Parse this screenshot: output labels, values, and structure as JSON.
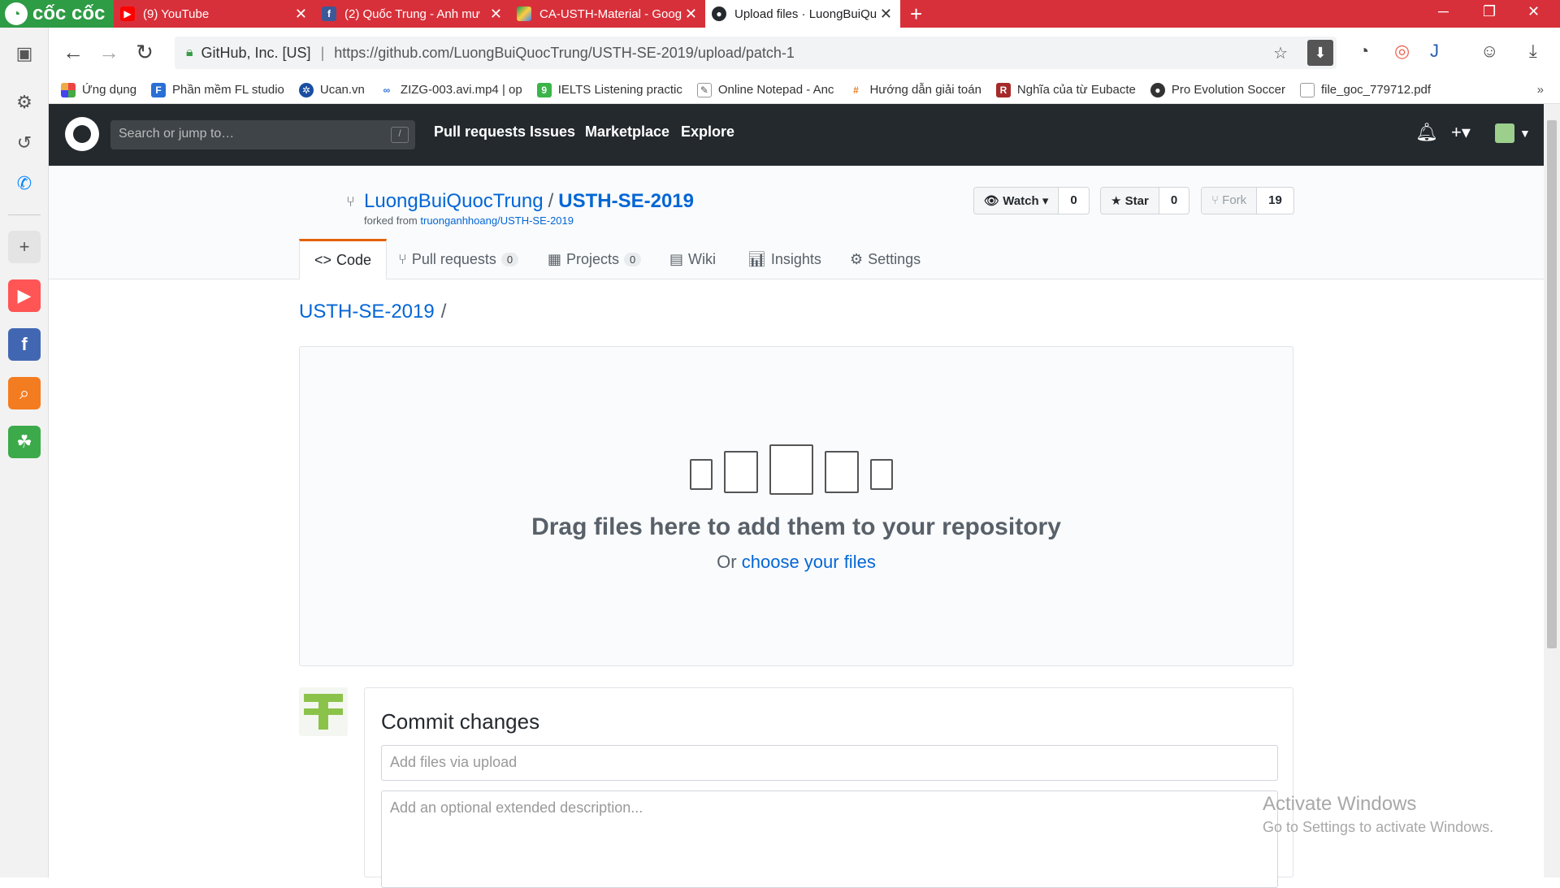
{
  "browser": {
    "brand": "cốc cốc",
    "tabs": [
      {
        "label": "(9) YouTube",
        "icon": "youtube-icon",
        "active": false
      },
      {
        "label": "(2) Quốc Trung - Anh mư",
        "icon": "facebook-icon",
        "active": false
      },
      {
        "label": "CA-USTH-Material - Goog",
        "icon": "google-drive-icon",
        "active": false
      },
      {
        "label": "Upload files · LuongBuiQu",
        "icon": "github-icon",
        "active": true
      }
    ],
    "new_tab": "+",
    "address": {
      "site": "GitHub, Inc. [US]",
      "url": "https://github.com/LuongBuiQuocTrung/USTH-SE-2019/upload/patch-1"
    },
    "bookmarks": [
      {
        "label": "Ứng dụng",
        "icon": "apps-grid-icon"
      },
      {
        "label": "Phần mềm FL studio",
        "icon": "fl-studio-icon"
      },
      {
        "label": "Ucan.vn",
        "icon": "ucan-icon"
      },
      {
        "label": "ZIZG-003.avi.mp4 | op",
        "icon": "link-icon"
      },
      {
        "label": "IELTS Listening practic",
        "icon": "ielts-icon"
      },
      {
        "label": "Online Notepad - Anc",
        "icon": "notepad-icon"
      },
      {
        "label": "Hướng dẫn giải toán",
        "icon": "math-icon"
      },
      {
        "label": "Nghĩa của từ Eubacte",
        "icon": "r-icon"
      },
      {
        "label": "Pro Evolution Soccer",
        "icon": "pes-icon"
      },
      {
        "label": "file_goc_779712.pdf",
        "icon": "file-icon"
      }
    ]
  },
  "github": {
    "search_placeholder": "Search or jump to…",
    "search_shortcut": "/",
    "nav": [
      "Pull requests",
      "Issues",
      "Marketplace",
      "Explore"
    ]
  },
  "repo": {
    "owner": "LuongBuiQuocTrung",
    "separator": "/",
    "name": "USTH-SE-2019",
    "forked_from_label": "forked from",
    "forked_from": "truonganhhoang/USTH-SE-2019",
    "watch": {
      "label": "Watch",
      "count": "0"
    },
    "star": {
      "label": "Star",
      "count": "0"
    },
    "fork": {
      "label": "Fork",
      "count": "19"
    },
    "tabs": [
      {
        "label": "Code",
        "count": null
      },
      {
        "label": "Pull requests",
        "count": "0"
      },
      {
        "label": "Projects",
        "count": "0"
      },
      {
        "label": "Wiki",
        "count": null
      },
      {
        "label": "Insights",
        "count": null
      },
      {
        "label": "Settings",
        "count": null
      }
    ]
  },
  "upload": {
    "breadcrumb": "USTH-SE-2019",
    "breadcrumb_sep": "/",
    "drag_title": "Drag files here to add them to your repository",
    "or_text": "Or",
    "choose_link": "choose your files"
  },
  "commit": {
    "title": "Commit changes",
    "summary_placeholder": "Add files via upload",
    "description_placeholder": "Add an optional extended description..."
  },
  "watermark": {
    "line1": "Activate Windows",
    "line2": "Go to Settings to activate Windows."
  },
  "colors": {
    "tabbar": "#d8303a",
    "brand": "#2e9b45",
    "github_header": "#24292e",
    "link": "#0366d6"
  }
}
